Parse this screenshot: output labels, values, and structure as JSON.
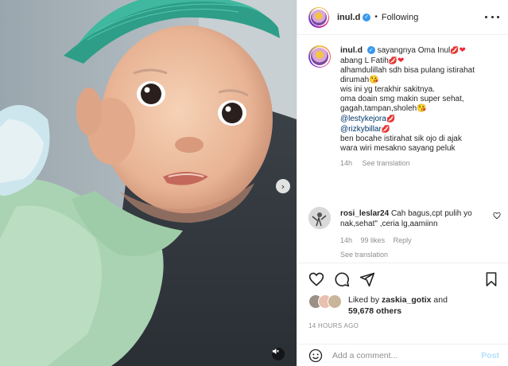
{
  "post": {
    "username": "inul.d",
    "separator": "•",
    "follow_status": "Following",
    "media_next_icon": "chevron-right-icon",
    "media_sound_icon": "speaker-muted-icon"
  },
  "caption": {
    "username": "inul.d",
    "lines": [
      "sayangnya Oma Inul",
      "abang L Fatih",
      "alhamdulillah sdh bisa pulang istirahat",
      "dirumah",
      "wis ini yg terakhir sakitnya.",
      "oma doain smg makin super sehat,",
      "gagah,tampan,sholeh",
      "@lestykejora",
      "@rizkybillar",
      "ben bocahe istirahat sik ojo di ajak",
      "wara wiri mesakno sayang",
      "peluk"
    ],
    "time": "14h",
    "see_translation": "See translation"
  },
  "comment": {
    "username": "rosi_leslar24",
    "text_line1": "Cah bagus,cpt pulih yo",
    "text_line2": "nak,sehat\" ,ceria lg,aamiinn",
    "time": "14h",
    "likes": "99 likes",
    "reply": "Reply",
    "see_translation": "See translation"
  },
  "likes": {
    "prefix": "Liked by",
    "user": "zaskia_gotix",
    "and": "and",
    "count": "59,678 others"
  },
  "timestamp": "14 HOURS AGO",
  "add_comment": {
    "placeholder": "Add a comment...",
    "post_label": "Post"
  },
  "colors": {
    "verified": "#3897f0",
    "link": "#00376b",
    "muted": "#8e8e8e",
    "post_disabled": "#b2dffc",
    "cap_green": "#3fb89f"
  }
}
